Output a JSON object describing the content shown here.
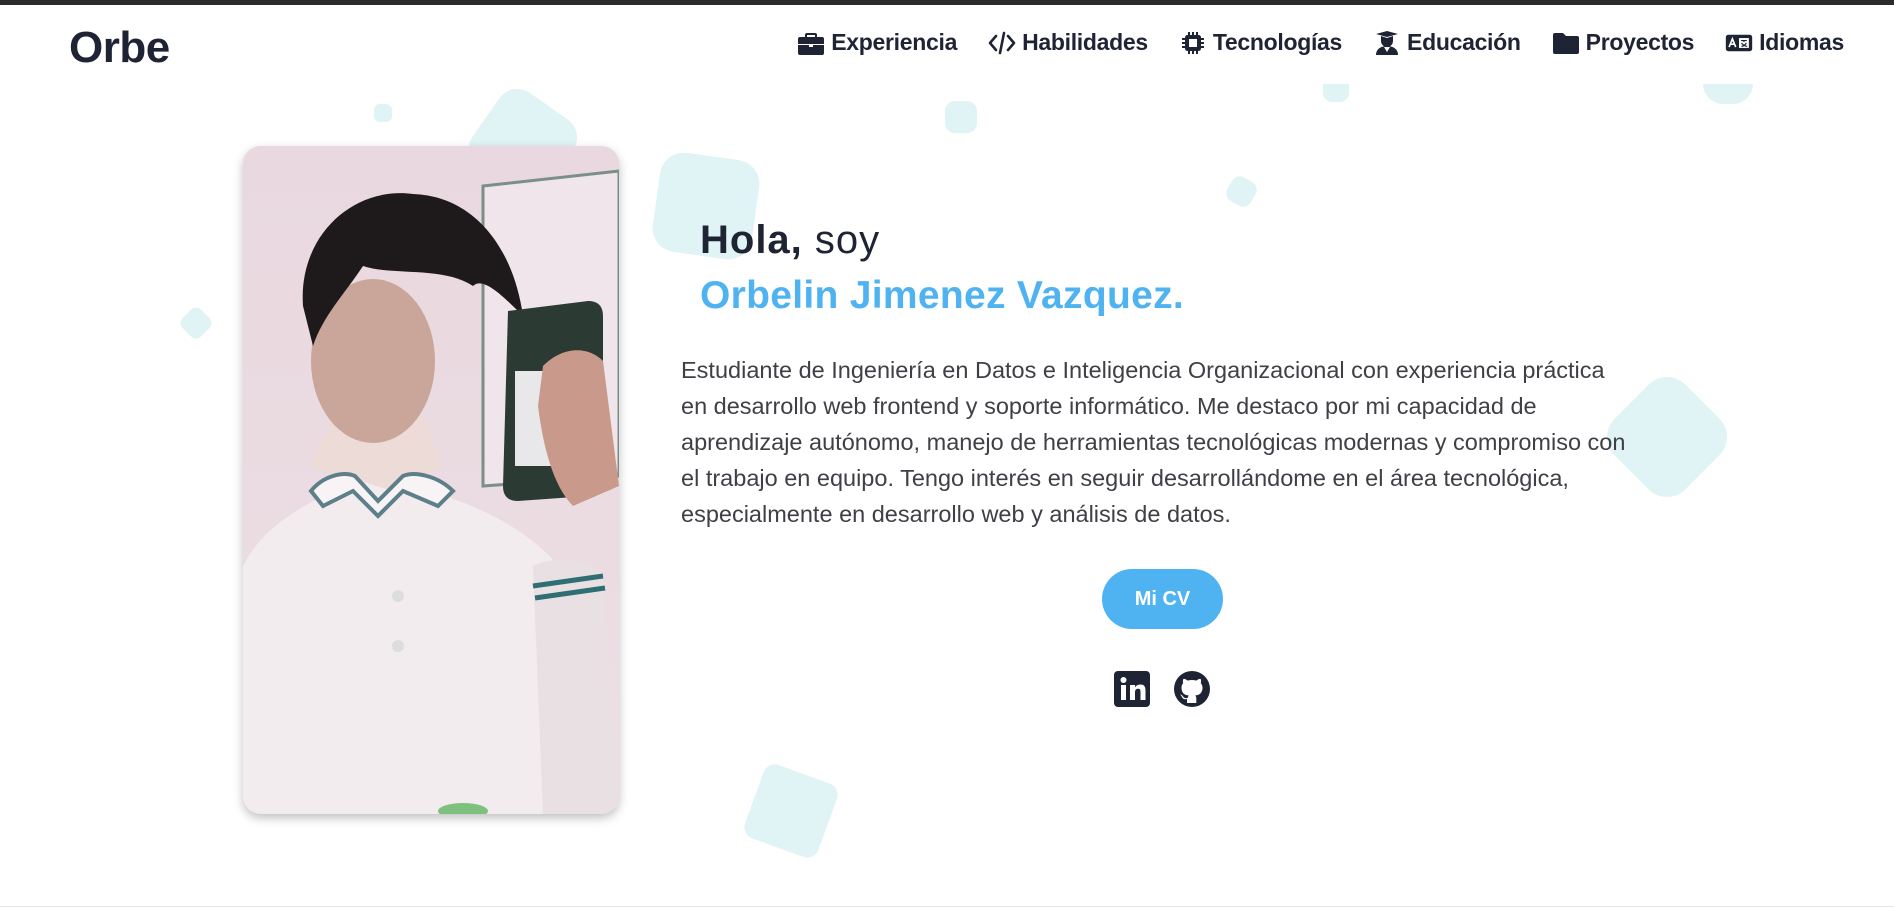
{
  "header": {
    "brand": "Orbe",
    "nav": [
      {
        "label": "Experiencia",
        "icon": "briefcase-icon"
      },
      {
        "label": "Habilidades",
        "icon": "code-icon"
      },
      {
        "label": "Tecnologías",
        "icon": "microchip-icon"
      },
      {
        "label": "Educación",
        "icon": "graduation-user-icon"
      },
      {
        "label": "Proyectos",
        "icon": "folder-icon"
      },
      {
        "label": "Idiomas",
        "icon": "language-card-icon"
      }
    ]
  },
  "hero": {
    "greeting_bold": "Hola,",
    "greeting_rest": " soy",
    "name": "Orbelin Jimenez Vazquez.",
    "bio": "Estudiante de Ingeniería en Datos e Inteligencia Organizacional con experiencia práctica en desarrollo web frontend y soporte informático. Me destaco por mi capacidad de aprendizaje autónomo, manejo de herramientas tecnológicas modernas y compromiso con el trabajo en equipo. Tengo interés en seguir desarrollándome en el área tecnológica, especialmente en desarrollo web y análisis de datos.",
    "cv_label": "Mi CV",
    "social": [
      {
        "icon": "linkedin-icon"
      },
      {
        "icon": "github-icon"
      }
    ]
  },
  "colors": {
    "accent": "#4fb3f2",
    "text_dark": "#1e2433",
    "shape": "#d6eff2"
  }
}
